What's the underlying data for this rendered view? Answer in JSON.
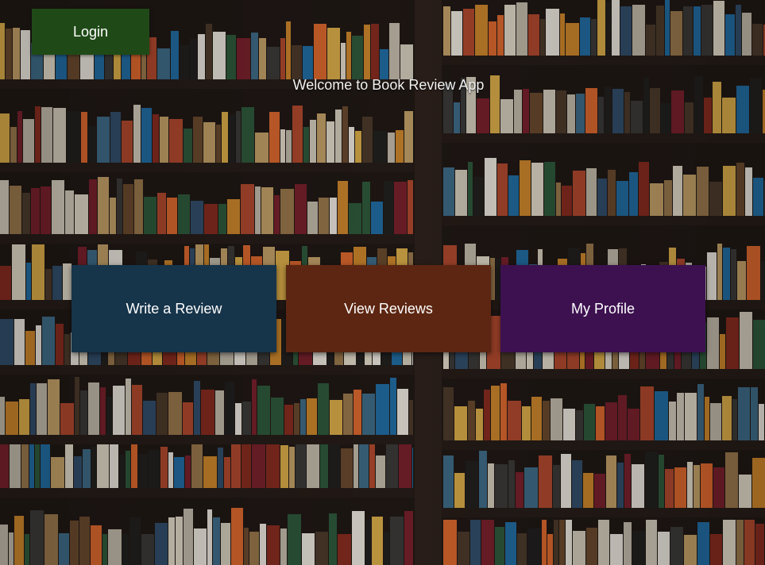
{
  "header": {
    "login_label": "Login"
  },
  "welcome_text": "Welcome to Book Review App",
  "cards": [
    {
      "label": "Write a Review",
      "color": "#16344a"
    },
    {
      "label": "View Reviews",
      "color": "#5c2612"
    },
    {
      "label": "My Profile",
      "color": "#3d1150"
    }
  ]
}
